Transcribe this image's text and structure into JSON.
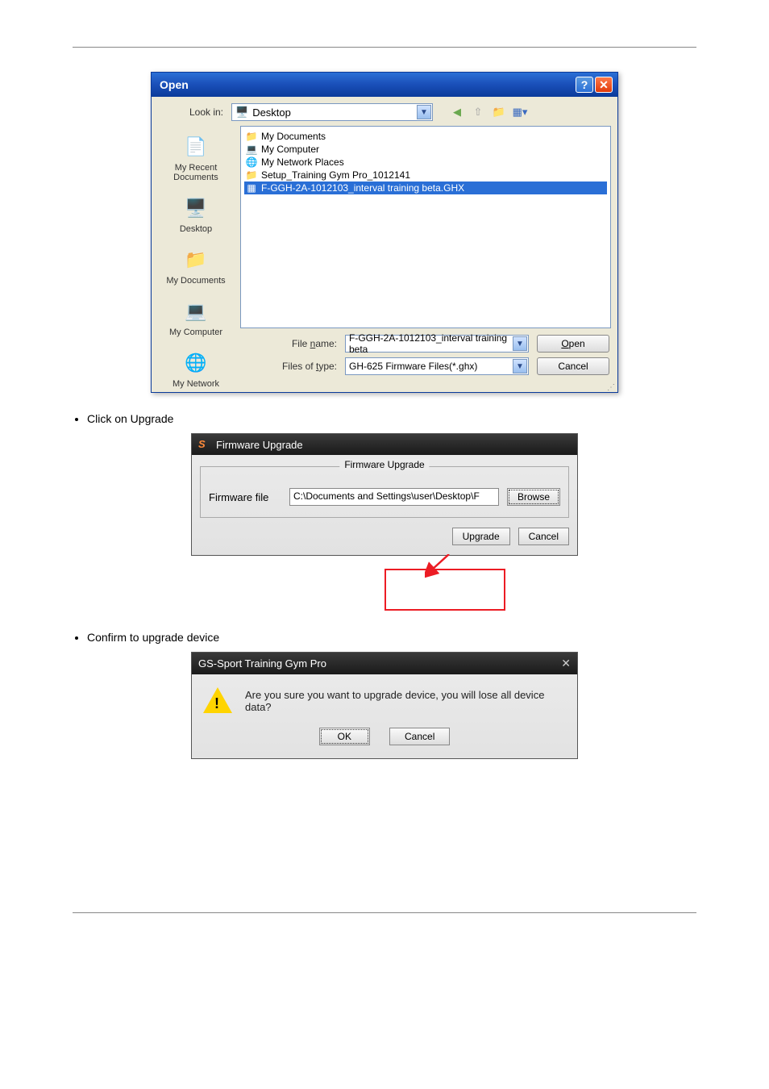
{
  "open_dialog": {
    "title": "Open",
    "look_in_label": "Look in:",
    "look_in_value": "Desktop",
    "sidebar": [
      {
        "label": "My Recent Documents"
      },
      {
        "label": "Desktop"
      },
      {
        "label": "My Documents"
      },
      {
        "label": "My Computer"
      },
      {
        "label": "My Network"
      }
    ],
    "files": [
      {
        "name": "My Documents",
        "type": "folder"
      },
      {
        "name": "My Computer",
        "type": "computer"
      },
      {
        "name": "My Network Places",
        "type": "network"
      },
      {
        "name": "Setup_Training Gym Pro_1012141",
        "type": "folder"
      },
      {
        "name": "F-GGH-2A-1012103_interval training beta.GHX",
        "type": "file",
        "selected": true
      }
    ],
    "file_name_label": "File name:",
    "file_name_value": "F-GGH-2A-1012103_interval training beta",
    "file_type_label": "Files of type:",
    "file_type_value": "GH-625 Firmware Files(*.ghx)",
    "open_btn": "Open",
    "cancel_btn": "Cancel"
  },
  "bullets": {
    "b1": "Click on Upgrade",
    "b2": "Confirm to upgrade device"
  },
  "fw_dialog": {
    "title": "Firmware Upgrade",
    "group_label": "Firmware Upgrade",
    "file_label": "Firmware file",
    "file_value": "C:\\Documents and Settings\\user\\Desktop\\F",
    "browse_btn": "Browse",
    "upgrade_btn": "Upgrade",
    "cancel_btn": "Cancel"
  },
  "confirm_dialog": {
    "title": "GS-Sport Training Gym Pro",
    "message": "Are you sure you want to upgrade device, you will lose all device data?",
    "ok_btn": "OK",
    "cancel_btn": "Cancel"
  },
  "footer": {
    "left": "",
    "right": ""
  }
}
